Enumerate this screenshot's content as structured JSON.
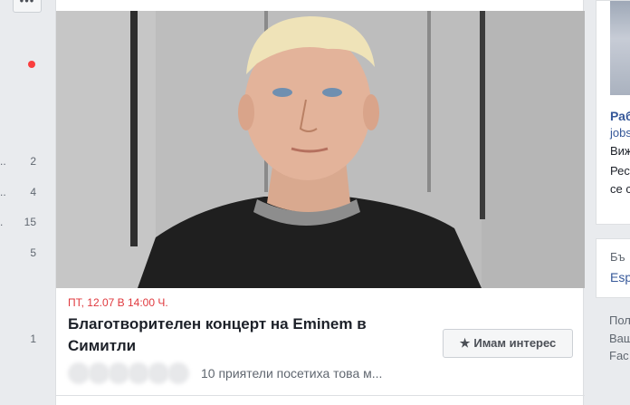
{
  "left_nav": {
    "more_label": "•••",
    "rows": [
      {
        "dots": "..",
        "count": "2"
      },
      {
        "dots": "..",
        "count": "4"
      },
      {
        "dots": ".",
        "count": "15"
      },
      {
        "dots": "",
        "count": "5"
      },
      {
        "dots": "",
        "count": "1"
      }
    ]
  },
  "event": {
    "date": "ПТ, 12.07 В 14:00 Ч.",
    "title": "Благотворителен концерт на Eminem в Симитли",
    "interest_star": "★",
    "interest_label": "Имам интерес",
    "friends_text": "10 приятели посетиха това м..."
  },
  "right_column": {
    "card1": {
      "title": "Раб",
      "link": "jobs",
      "lines": [
        "Виж",
        "Рес",
        "се с"
      ]
    },
    "card2": {
      "line1": "Бъ",
      "line2": "Esp"
    },
    "footer": [
      "Пол",
      "Ваш",
      "Fac"
    ]
  },
  "colors": {
    "date_red": "#e0393e",
    "link_blue": "#365899",
    "page_bg": "#e9ebee",
    "notification_dot": "#fa3e3e"
  }
}
